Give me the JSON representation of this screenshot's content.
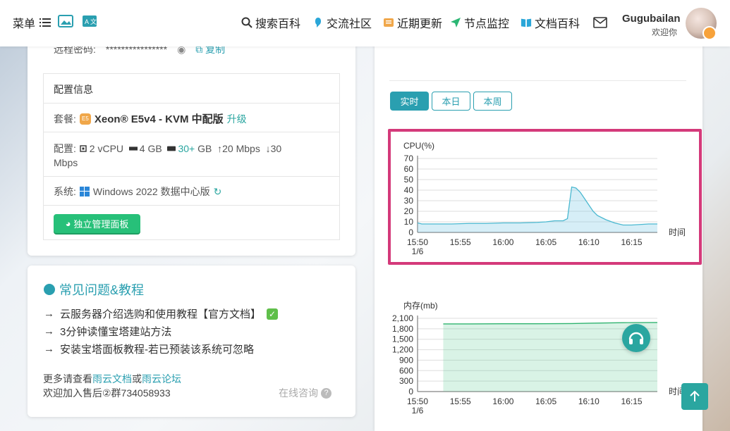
{
  "nav": {
    "menu_label": "菜单",
    "items": [
      {
        "label": "搜索百科",
        "icon": "search-icon"
      },
      {
        "label": "交流社区",
        "icon": "chat-icon"
      },
      {
        "label": "近期更新",
        "icon": "updates-icon"
      },
      {
        "label": "节点监控",
        "icon": "send-icon"
      },
      {
        "label": "文档百科",
        "icon": "book-icon"
      }
    ],
    "user_name": "Gugubailan",
    "user_greeting": "欢迎你"
  },
  "server": {
    "password_label": "远程密码:",
    "password_masked": "****************",
    "copy_label": "复制",
    "config_title": "配置信息",
    "plan_label": "套餐:",
    "plan_badge": "E5",
    "plan_name": "Xeon® E5v4 - KVM 中配版",
    "upgrade_label": "升级",
    "spec_label": "配置:",
    "spec_cpu": "2 vCPU",
    "spec_ram": "4 GB",
    "spec_disk_prefix": "30+",
    "spec_disk_unit": "GB",
    "spec_up": "20 Mbps",
    "spec_down": "30",
    "spec_down_unit": "Mbps",
    "os_label": "系统:",
    "os_name": "Windows 2022 数据中心版",
    "panel_button": "独立管理面板"
  },
  "faq": {
    "title": "常见问题&教程",
    "items": [
      "云服务器介绍选购和使用教程【官方文档】",
      "3分钟读懂宝塔建站方法",
      "安装宝塔面板教程-若已预装该系统可忽略"
    ],
    "more_prefix": "更多请查看",
    "more_link1": "雨云文档",
    "more_or": "或",
    "more_link2": "雨云论坛",
    "join_text": "欢迎加入售后②群734058933",
    "consult_label": "在线咨询"
  },
  "monitor": {
    "tabs": [
      "实时",
      "本日",
      "本周"
    ],
    "active_tab": "实时"
  },
  "colors": {
    "accent": "#2a9fb0",
    "green": "#27c079",
    "highlight": "#d43a7a"
  },
  "chart_data": [
    {
      "type": "area",
      "title": "",
      "ylabel": "CPU(%)",
      "xlabel": "时间",
      "ylim": [
        0,
        70
      ],
      "yticks": [
        0,
        10,
        20,
        30,
        40,
        50,
        60,
        70
      ],
      "xticks": [
        "15:50\n1/6",
        "15:55",
        "16:00",
        "16:05",
        "16:10",
        "16:15"
      ],
      "x_minutes": [
        0,
        0.5,
        1,
        2,
        4,
        6,
        8,
        10,
        12,
        14,
        15,
        16,
        17,
        17.5,
        18,
        18.5,
        19,
        19.5,
        20,
        20.5,
        21,
        22,
        23,
        24,
        25,
        26,
        27,
        28
      ],
      "values": [
        9,
        8,
        8,
        8,
        8,
        8.5,
        8.5,
        9,
        9,
        9.5,
        10,
        11,
        11,
        13,
        43,
        42,
        38,
        32,
        26,
        20,
        16,
        12,
        9,
        7,
        7,
        7.5,
        8,
        8
      ],
      "grid": true
    },
    {
      "type": "area",
      "title": "",
      "ylabel": "内存(mb)",
      "xlabel": "时间",
      "ylim": [
        0,
        2100
      ],
      "yticks": [
        0,
        300,
        600,
        900,
        1200,
        1500,
        1800,
        2100
      ],
      "xticks": [
        "15:50\n1/6",
        "15:55",
        "16:00",
        "16:05",
        "16:10",
        "16:15"
      ],
      "x_minutes": [
        3,
        6,
        10,
        14,
        18,
        20,
        24,
        28
      ],
      "values": [
        1940,
        1940,
        1945,
        1945,
        1950,
        1960,
        1975,
        1980
      ],
      "grid": true
    }
  ]
}
